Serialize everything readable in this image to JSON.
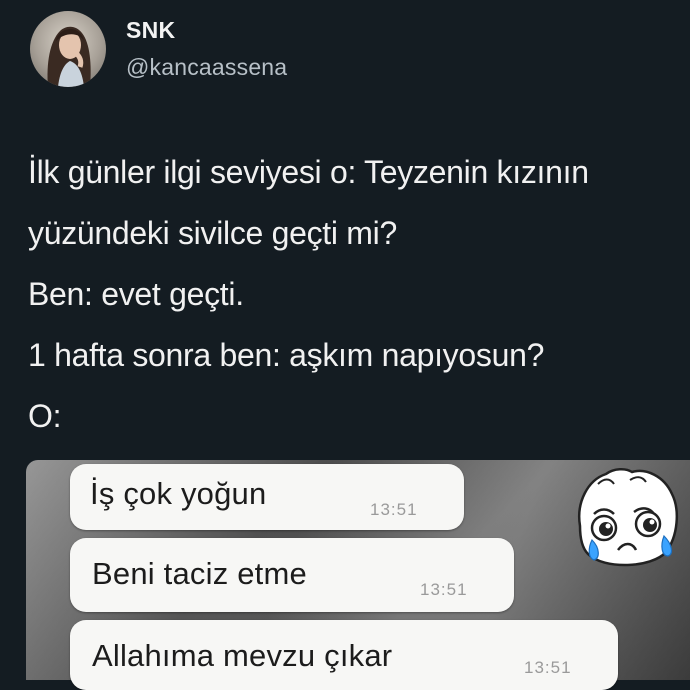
{
  "user": {
    "display_name": "SNK",
    "handle": "@kancaassena"
  },
  "tweet": {
    "lines": [
      "İlk günler ilgi seviyesi o: Teyzenin kızının",
      "yüzündeki sivilce geçti mi?",
      "Ben: evet geçti.",
      "1 hafta sonra ben: aşkım napıyosun?",
      "O:"
    ]
  },
  "chat": {
    "messages": [
      {
        "text": "İş çok yoğun",
        "time": "13:51"
      },
      {
        "text": "Beni taciz etme",
        "time": "13:51"
      },
      {
        "text": "Allahıma mevzu çıkar",
        "time": "13:51"
      }
    ]
  },
  "sticker": {
    "icon": "crying-face-icon"
  },
  "colors": {
    "background": "#141c22",
    "text": "#f1f1f1",
    "handle": "#b7c0c7",
    "bubble": "#f7f7f5"
  }
}
